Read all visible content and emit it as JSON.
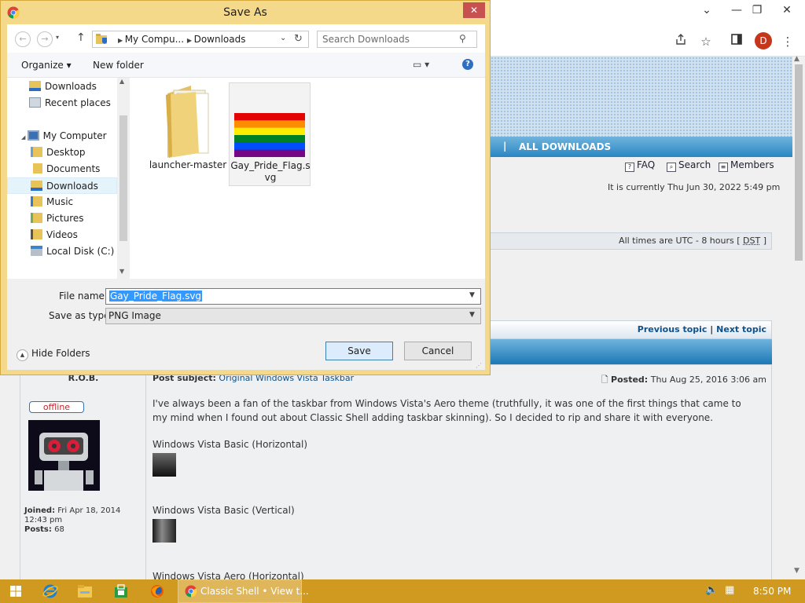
{
  "browser": {
    "controls": {
      "minimize": "⌄",
      "restore": "—",
      "maximize": "❐",
      "close": "✕"
    },
    "toolbar_icons": [
      "share-icon",
      "star-icon",
      "sidebar-icon",
      "profile-avatar",
      "menu-icon"
    ],
    "profile_initial": "D"
  },
  "forum": {
    "nav_sep": "|",
    "nav_all_downloads": "ALL DOWNLOADS",
    "links": {
      "faq": "FAQ",
      "search": "Search",
      "members": "Members"
    },
    "currently": "It is currently Thu Jun 30, 2022 5:49 pm",
    "times_prefix": "All times are UTC - 8 hours [",
    "times_dst": "DST",
    "times_suffix": "]",
    "previous_topic": "Previous topic",
    "topic_sep": "|",
    "next_topic": "Next topic",
    "post": {
      "author": "R.O.B.",
      "status": "offline",
      "joined_label": "Joined:",
      "joined_value": "Fri Apr 18, 2014 12:43 pm",
      "posts_label": "Posts:",
      "posts_value": "68",
      "subject_label": "Post subject:",
      "subject_value": "Original Windows Vista Taskbar",
      "posted_label": "Posted:",
      "posted_value": "Thu Aug 25, 2016 3:06 am",
      "body": "I've always been a fan of the taskbar from Windows Vista's Aero theme (truthfully, it was one of the first things that came to my mind when I found out about Classic Shell adding taskbar skinning). So I decided to rip and share it with everyone.",
      "caption1": "Windows Vista Basic (Horizontal)",
      "caption2": "Windows Vista Basic (Vertical)",
      "caption3": "Windows Vista Aero (Horizontal)"
    }
  },
  "dialog": {
    "title": "Save As",
    "close": "✕",
    "address": {
      "seg1": "My Compu...",
      "seg2": "Downloads"
    },
    "search_placeholder": "Search Downloads",
    "organize": "Organize ▾",
    "new_folder": "New folder",
    "help": "?",
    "nav_items": [
      {
        "label": "Downloads"
      },
      {
        "label": "Recent places"
      },
      {
        "label": "My Computer"
      },
      {
        "label": "Desktop"
      },
      {
        "label": "Documents"
      },
      {
        "label": "Downloads"
      },
      {
        "label": "Music"
      },
      {
        "label": "Pictures"
      },
      {
        "label": "Videos"
      },
      {
        "label": "Local Disk (C:)"
      }
    ],
    "files": [
      {
        "name": "launcher-master",
        "type": "folder"
      },
      {
        "name": "Gay_Pride_Flag.svg",
        "type": "image"
      }
    ],
    "file_name_label": "File name:",
    "file_name_value": "Gay_Pride_Flag.svg",
    "save_type_label": "Save as type:",
    "save_type_value": "PNG Image",
    "hide_folders": "Hide Folders",
    "save": "Save",
    "cancel": "Cancel",
    "flag_colors": [
      "#e40303",
      "#ff8c00",
      "#ffed00",
      "#008026",
      "#004dff",
      "#750787"
    ]
  },
  "taskbar": {
    "active_label": "Classic Shell • View t...",
    "clock": "8:50 PM"
  }
}
